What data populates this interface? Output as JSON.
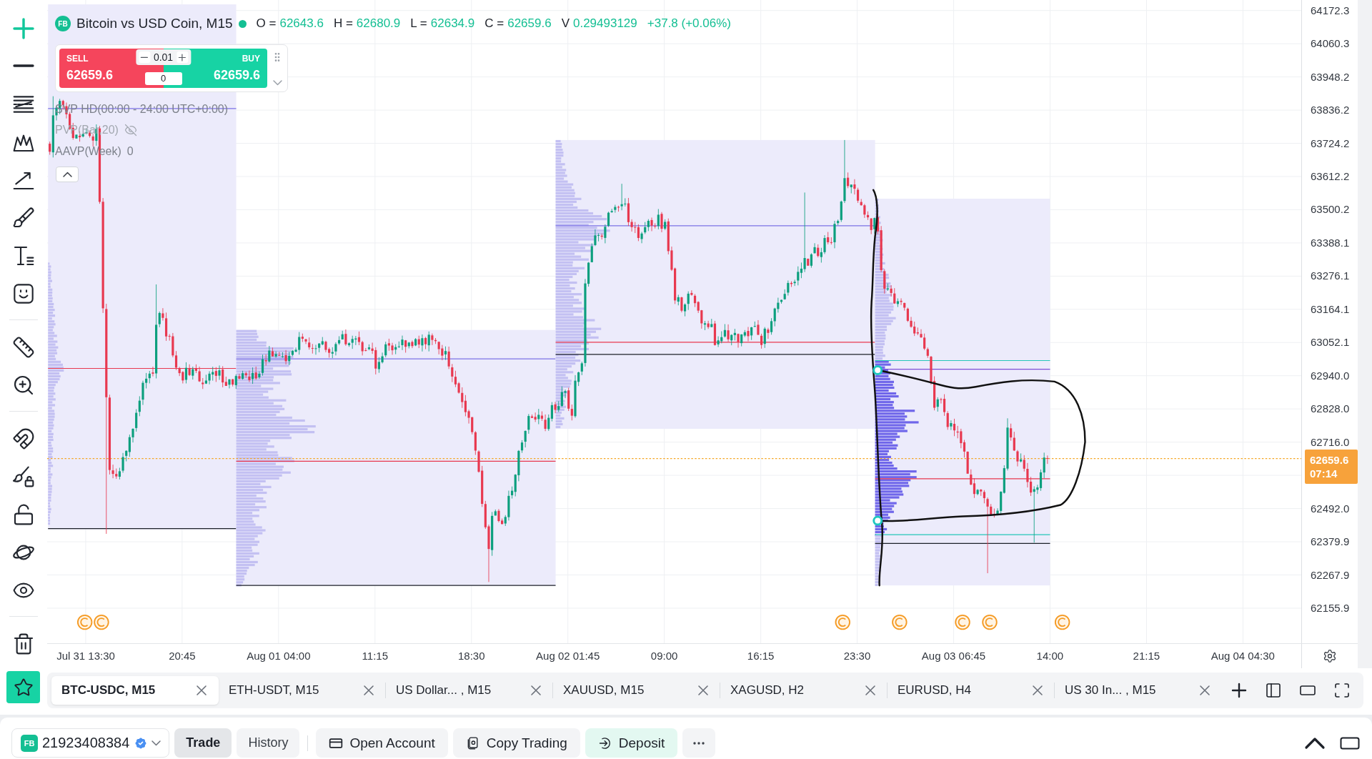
{
  "toolbar": {
    "groups": [
      {
        "tools": [
          {
            "kind": "crosshair",
            "selected": true
          },
          {
            "kind": "line",
            "selected": false
          },
          {
            "kind": "channel",
            "selected": false
          },
          {
            "kind": "pattern",
            "selected": false
          },
          {
            "kind": "projection",
            "selected": false
          },
          {
            "kind": "brush",
            "selected": false
          },
          {
            "kind": "text",
            "selected": false
          },
          {
            "kind": "emoji",
            "selected": false
          }
        ]
      },
      {
        "tools": [
          {
            "kind": "ruler",
            "selected": false
          },
          {
            "kind": "zoom",
            "selected": false
          }
        ]
      },
      {
        "tools": [
          {
            "kind": "magnet",
            "selected": false
          },
          {
            "kind": "lock-brush",
            "selected": false
          },
          {
            "kind": "lock",
            "selected": false
          },
          {
            "kind": "planet",
            "selected": false
          },
          {
            "kind": "eye",
            "selected": false
          }
        ]
      },
      {
        "tools": [
          {
            "kind": "delete",
            "selected": false
          }
        ]
      }
    ]
  },
  "legend": {
    "badge": "FB",
    "title": "Bitcoin vs USD Coin, M15",
    "market_open": true,
    "ohlc": [
      {
        "label": "O =",
        "value": "62643.6"
      },
      {
        "label": "H =",
        "value": "62680.9"
      },
      {
        "label": "L =",
        "value": "62634.9"
      },
      {
        "label": "C =",
        "value": "62659.6"
      },
      {
        "label": "V",
        "value": "0.29493129"
      }
    ],
    "change": "+37.8 (+0.06%)"
  },
  "trade_panel": {
    "sell": {
      "label": "SELL",
      "price": "62659.6"
    },
    "buy": {
      "label": "BUY",
      "price": "62659.6"
    },
    "lot_size": "0.01",
    "quantity": "0"
  },
  "indicator_panel": {
    "expanded": true,
    "items": [
      {
        "name": "SVP HD(00:00 - 24:00 UTC+0:00)",
        "hidden": false
      },
      {
        "name": "PVP(Bar,20)",
        "hidden": true
      },
      {
        "name": "AAVP(Week)",
        "value": "0",
        "hidden": false
      }
    ]
  },
  "price_axis": {
    "labels": [
      "64172.3",
      "64060.3",
      "63948.2",
      "63836.2",
      "63724.2",
      "63612.2",
      "63500.2",
      "63388.1",
      "63276.1",
      "63164.1",
      "63052.1",
      "62940.0",
      "62828.0",
      "62716.0",
      "62492.0",
      "62379.9",
      "62267.9",
      "62155.9"
    ],
    "current_price": "62659.6",
    "countdown": "07:14"
  },
  "time_axis": {
    "labels": [
      "Jul 31 13:30",
      "20:45",
      "Aug 01 04:00",
      "11:15",
      "18:30",
      "Aug 02 01:45",
      "09:00",
      "16:15",
      "23:30",
      "Aug 03 06:45",
      "14:00",
      "21:15",
      "Aug 04 04:30"
    ]
  },
  "chart_tabs": [
    {
      "label": "BTC-USDC, M15",
      "selected": true
    },
    {
      "label": "ETH-USDT, M15",
      "selected": false
    },
    {
      "label": "US Dollar... , M15",
      "selected": false
    },
    {
      "label": "XAUUSD, M15",
      "selected": false
    },
    {
      "label": "XAGUSD, H2",
      "selected": false
    },
    {
      "label": "EURUSD, H4",
      "selected": false
    },
    {
      "label": "US 30 In... , M15",
      "selected": false
    }
  ],
  "account_bar": {
    "account": {
      "badge": "FB",
      "number": "21923408384",
      "verified": true
    },
    "views": [
      {
        "label": "Trade",
        "selected": true
      },
      {
        "label": "History",
        "selected": false
      }
    ],
    "actions": [
      {
        "kind": "open-account",
        "label": "Open Account"
      },
      {
        "kind": "copy-trading",
        "label": "Copy Trading"
      },
      {
        "kind": "deposit",
        "label": "Deposit"
      }
    ]
  }
}
